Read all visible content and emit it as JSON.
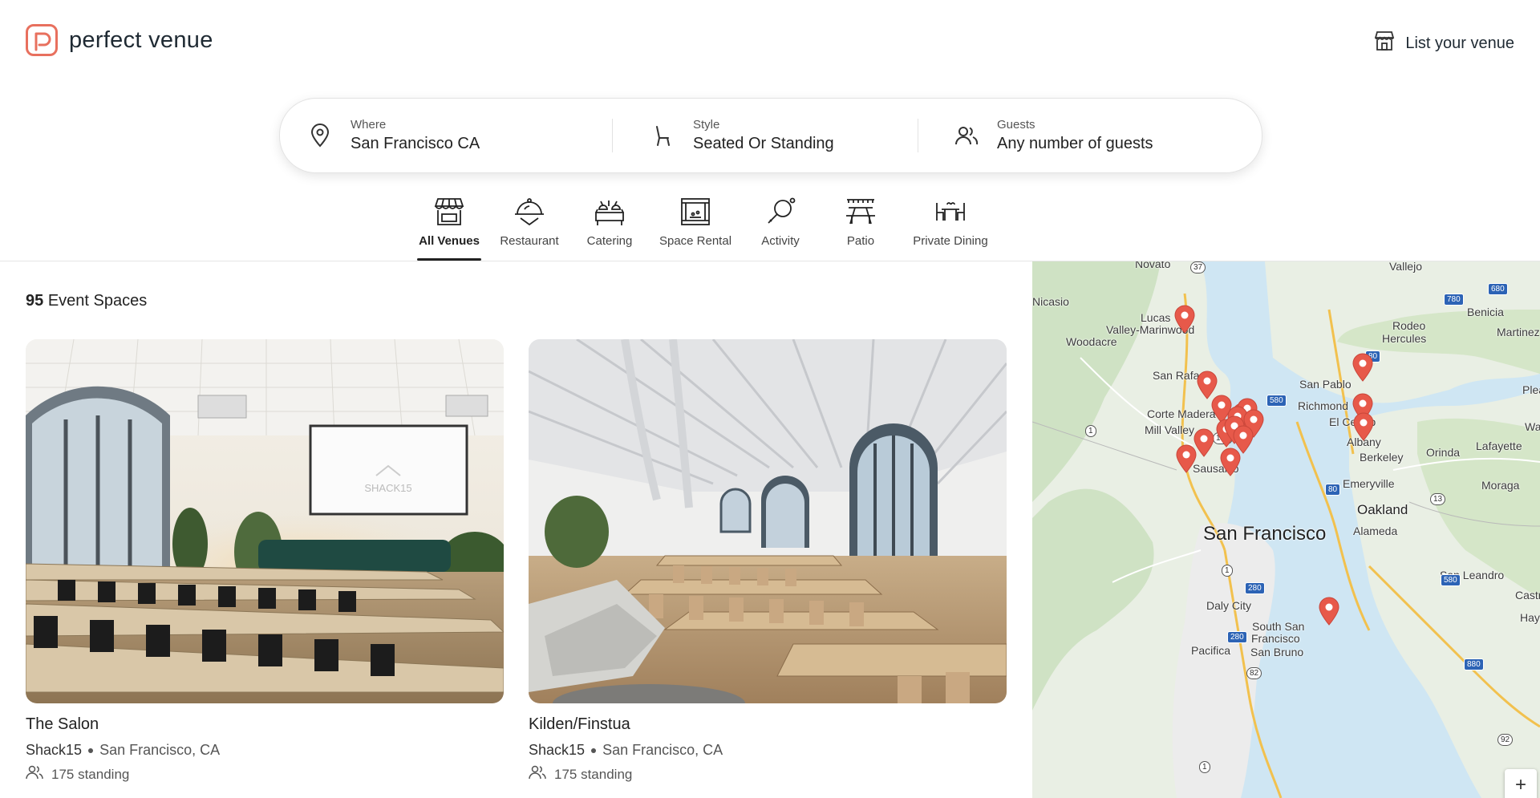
{
  "header": {
    "brand": "perfect venue",
    "list_venue_label": "List your venue"
  },
  "search": {
    "where": {
      "label": "Where",
      "value": "San Francisco CA"
    },
    "style": {
      "label": "Style",
      "value": "Seated Or Standing"
    },
    "guests": {
      "label": "Guests",
      "value": "Any number of guests"
    }
  },
  "categories": [
    {
      "label": "All Venues",
      "active": true
    },
    {
      "label": "Restaurant"
    },
    {
      "label": "Catering"
    },
    {
      "label": "Space Rental"
    },
    {
      "label": "Activity"
    },
    {
      "label": "Patio"
    },
    {
      "label": "Private Dining"
    }
  ],
  "results": {
    "count": "95",
    "count_label": "Event Spaces"
  },
  "venues": [
    {
      "name": "The Salon",
      "host": "Shack15",
      "city": "San Francisco, CA",
      "capacity": "175 standing",
      "screen_text": "SHACK15"
    },
    {
      "name": "Kilden/Finstua",
      "host": "Shack15",
      "city": "San Francisco, CA",
      "capacity": "175 standing"
    }
  ],
  "map": {
    "labels": {
      "novato": "Novato",
      "vallejo": "Vallejo",
      "nicasio": "Nicasio",
      "lucas": "Lucas",
      "valley_marinwood": "Valley-Marinwood",
      "woodacre": "Woodacre",
      "benicia": "Benicia",
      "rodeo": "Rodeo",
      "hercules": "Hercules",
      "martinez": "Martinez",
      "san_rafael": "San Rafael",
      "san_pablo": "San Pablo",
      "richmond": "Richmond",
      "plea": "Plea",
      "corte_madera": "Corte Madera",
      "mill_valley": "Mill Valley",
      "el_cerrito": "El Cerrito",
      "waln": "Waln",
      "albany": "Albany",
      "berkeley": "Berkeley",
      "orinda": "Orinda",
      "lafayette": "Lafayette",
      "sausalito": "Sausalito",
      "emeryville": "Emeryville",
      "moraga": "Moraga",
      "oakland": "Oakland",
      "san_francisco": "San Francisco",
      "alameda": "Alameda",
      "san_leandro": "San Leandro",
      "castro": "Castro",
      "hayw": "Hayw",
      "daly_city": "Daly City",
      "south_san_francisco_1": "South San",
      "south_san_francisco_2": "Francisco",
      "pacifica": "Pacifica",
      "san_bruno": "San Bruno"
    },
    "shields": [
      "37",
      "780",
      "680",
      "80",
      "580",
      "1",
      "131",
      "80",
      "13",
      "580",
      "1",
      "280",
      "880",
      "280",
      "82",
      "92",
      "1"
    ],
    "zoom_label": "+"
  }
}
